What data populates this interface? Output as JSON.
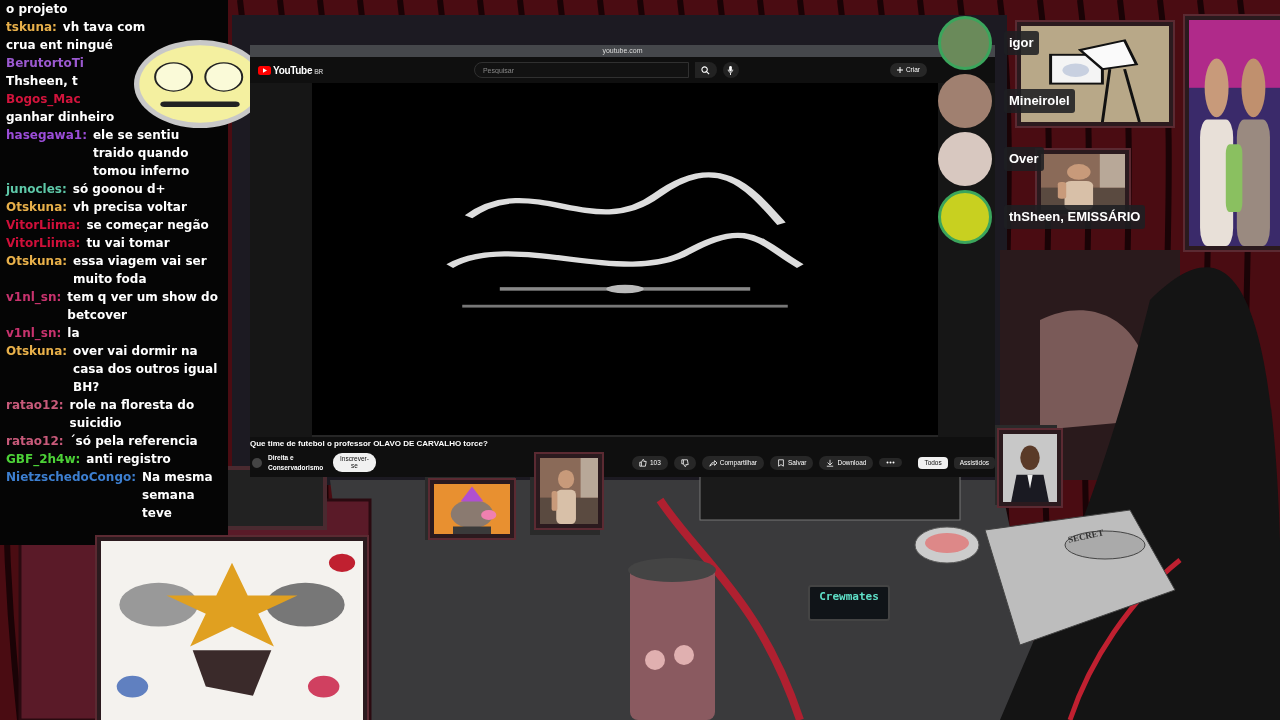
{
  "chat": {
    "messages": [
      {
        "text": "o projeto"
      },
      {
        "user": "tskuna:",
        "color": "#e8b04a",
        "text": "vh tava com"
      },
      {
        "text": "crua ent ningué"
      },
      {
        "user": "BerutortoTi",
        "color": "#9b59d0"
      },
      {
        "text": "Thsheen, t"
      },
      {
        "user": "Bogos_Mac",
        "color": "#d2143c"
      },
      {
        "text": "ganhar dinheiro"
      },
      {
        "user": "hasegawa1:",
        "color": "#9b4dd8",
        "text": "ele se sentiu traido quando tomou inferno"
      },
      {
        "user": "junocles:",
        "color": "#5ec8a8",
        "text": "só goonou d+"
      },
      {
        "user": "Otskuna:",
        "color": "#e8b04a",
        "text": "vh precisa voltar"
      },
      {
        "user": "VitorLiima:",
        "color": "#d0103a",
        "text": "se começar negão"
      },
      {
        "user": "VitorLiima:",
        "color": "#d0103a",
        "text": "tu vai tomar"
      },
      {
        "user": "Otskuna:",
        "color": "#e8b04a",
        "text": "essa viagem vai ser muito foda"
      },
      {
        "user": "v1nl_sn:",
        "color": "#c8336e",
        "text": "tem q ver um show do betcover"
      },
      {
        "user": "v1nl_sn:",
        "color": "#c8336e",
        "text": "la"
      },
      {
        "user": "Otskuna:",
        "color": "#e8b04a",
        "text": "over vai dormir na casa dos outros igual BH?"
      },
      {
        "user": "ratao12:",
        "color": "#c85a7a",
        "text": "role na floresta do suicidio"
      },
      {
        "user": "ratao12:",
        "color": "#c85a7a",
        "text": "´só pela referencia"
      },
      {
        "user": "GBF_2h4w:",
        "color": "#4cd137",
        "text": "anti registro"
      },
      {
        "user": "NietzschedoCongo:",
        "color": "#3d7fd0",
        "text": "Na mesma semana teve"
      }
    ]
  },
  "browser": {
    "address": "youtube.com",
    "logo": "YouTube",
    "region": "BR",
    "search": {
      "placeholder": "Pesquisar"
    },
    "create_button": "Criar",
    "title": "Que time de futebol o professor OLAVO DE CARVALHO torce?",
    "channel": "Direita e Conservadorismo",
    "subscribe": "Inscrever-se",
    "likes": "103",
    "actions": [
      {
        "kind": "share",
        "label": "Compartilhar"
      },
      {
        "kind": "save",
        "label": "Salvar"
      },
      {
        "kind": "download",
        "label": "Download"
      }
    ],
    "chips": [
      {
        "label": "Todos",
        "selected": true
      },
      {
        "label": "Assistidos",
        "selected": false
      }
    ]
  },
  "voice": {
    "members": [
      {
        "name": "igor",
        "speaking": true
      },
      {
        "name": "Mineirolel",
        "speaking": false
      },
      {
        "name": "Over",
        "speaking": false
      },
      {
        "name": "thSheen, EMISSÁRIO",
        "speaking": true
      }
    ]
  },
  "scene": {
    "sign": "Crewmates",
    "box_label": "SECRET"
  }
}
